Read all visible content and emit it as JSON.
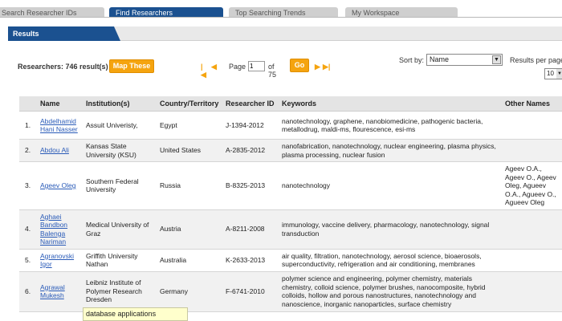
{
  "tabs": [
    {
      "label": "Search Researcher IDs"
    },
    {
      "label": "Find Researchers"
    },
    {
      "label": "Top Searching Trends"
    },
    {
      "label": "My Workspace"
    }
  ],
  "results_tab": "Results",
  "toolbar": {
    "count_label": "Researchers: 746 result(s)",
    "map_button": "Map These",
    "first_icon": "|◀",
    "prev_icon": "◀",
    "page_label": "Page",
    "page_value": "1",
    "of_label": "of 75",
    "go_button": "Go",
    "next_icon": "▶",
    "last_icon": "▶|",
    "sort_label": "Sort by:",
    "sort_value": "Name",
    "rpp_label": "Results per page:",
    "rpp_value": "10"
  },
  "table": {
    "headers": [
      "",
      "Name",
      "Institution(s)",
      "Country/Territory",
      "Researcher ID",
      "Keywords",
      "Other Names"
    ],
    "rows": [
      {
        "num": "1.",
        "name": "Abdelhamid Hani Nasser",
        "inst": "Assuit Univeristy,",
        "country": "Egypt",
        "rid": "J-1394-2012",
        "keywords": "nanotechnology, graphene, nanobiomedicine, pathogenic bacteria, metallodrug, maldi-ms, flourescence, esi-ms",
        "other": ""
      },
      {
        "num": "2.",
        "name": "Abdou Ali",
        "inst": "Kansas State University (KSU)",
        "country": "United States",
        "rid": "A-2835-2012",
        "keywords": "nanofabrication, nanotechnology, nuclear engineering, plasma physics, plasma processing, nuclear fusion",
        "other": ""
      },
      {
        "num": "3.",
        "name": "Ageev Oleg",
        "inst": "Southern Federal University",
        "country": "Russia",
        "rid": "B-8325-2013",
        "keywords": "nanotechnology",
        "other": "Ageev O.A., Ageev O., Ageev Oleg, Agueev O.A., Agueev O., Agueev Oleg"
      },
      {
        "num": "4.",
        "name": "Aghaei Bandbon Balenga Nariman",
        "inst": "Medical University of Graz",
        "country": "Austria",
        "rid": "A-8211-2008",
        "keywords": "immunology, vaccine delivery, pharmacology, nanotechnology, signal transduction",
        "other": ""
      },
      {
        "num": "5.",
        "name": "Agranovski Igor",
        "inst": "Griffith University Nathan",
        "country": "Australia",
        "rid": "K-2633-2013",
        "keywords": "air quality, filtration, nanotechnology, aerosol science, bioaerosols, superconductivity, refrigeration and air conditioning, membranes",
        "other": ""
      },
      {
        "num": "6.",
        "name": "Agrawal Mukesh",
        "inst": "Leibniz Institute of Polymer Research Dresden",
        "country": "Germany",
        "rid": "F-6741-2010",
        "keywords": "polymer science and engineering, polymer chemistry, materials chemistry, colloid science, polymer brushes, nanocomposite, hybrid colloids, hollow and porous nanostructures, nanotechnology and nanoscience, inorganic nanoparticles, surface chemistry",
        "other": ""
      }
    ]
  },
  "tooltip": "database applications",
  "colors": {
    "brand_blue": "#1b5190",
    "accent_orange": "#f5a40f",
    "link": "#2a5bb8"
  }
}
